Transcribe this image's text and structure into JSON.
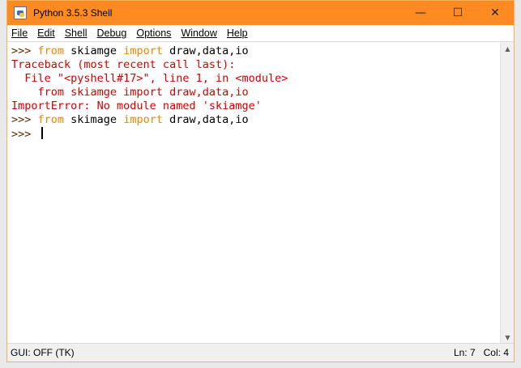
{
  "window": {
    "title": "Python 3.5.3 Shell",
    "controls": {
      "minimize": "—",
      "maximize": "☐",
      "close": "✕"
    }
  },
  "menu": [
    {
      "label": "File"
    },
    {
      "label": "Edit"
    },
    {
      "label": "Shell"
    },
    {
      "label": "Debug"
    },
    {
      "label": "Options"
    },
    {
      "label": "Window"
    },
    {
      "label": "Help"
    }
  ],
  "shell": {
    "lines": [
      {
        "prompt": ">>> ",
        "kw1": "from",
        "mod": " skiamge ",
        "kw2": "import",
        "rest": " draw,data,io"
      },
      {
        "err": "Traceback (most recent call last):"
      },
      {
        "err": "  File \"<pyshell#17>\", line 1, in <module>"
      },
      {
        "err": "    from skiamge import draw,data,io"
      },
      {
        "err": "ImportError: No module named 'skiamge'"
      },
      {
        "prompt": ">>> ",
        "kw1": "from",
        "mod": " skimage ",
        "kw2": "import",
        "rest": " draw,data,io"
      },
      {
        "prompt": ">>> "
      }
    ]
  },
  "status": {
    "gui": "GUI: OFF (TK)",
    "line": "Ln: 7",
    "col": "Col: 4"
  },
  "colors": {
    "titlebar": "#fe8a22",
    "keyword": "#f28500",
    "error": "#d40000",
    "prompt": "#5c2c00"
  }
}
